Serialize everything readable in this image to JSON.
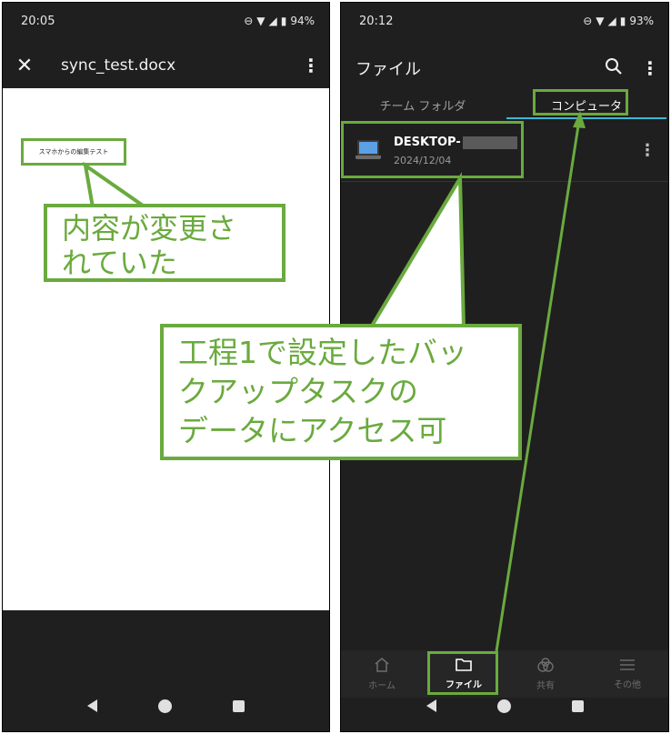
{
  "left_phone": {
    "status": {
      "time": "20:05",
      "battery": "94%"
    },
    "toolbar": {
      "title": "sync_test.docx"
    },
    "document": {
      "text": "スマホからの編集テスト"
    }
  },
  "right_phone": {
    "status": {
      "time": "20:12",
      "battery": "93%"
    },
    "toolbar": {
      "title": "ファイル"
    },
    "tabs": [
      {
        "label": "チーム フォルダ",
        "active": false
      },
      {
        "label": "コンピュータ",
        "active": true
      }
    ],
    "file": {
      "name": "DESKTOP-",
      "date": "2024/12/04"
    },
    "bottom_nav": [
      {
        "label": "ホーム",
        "icon": "home-icon",
        "active": false
      },
      {
        "label": "ファイル",
        "icon": "folder-icon",
        "active": true
      },
      {
        "label": "共有",
        "icon": "share-icon",
        "active": false
      },
      {
        "label": "その他",
        "icon": "menu-icon",
        "active": false
      }
    ]
  },
  "annotations": {
    "left_callout": {
      "line1": "内容が変更さ",
      "line2": "れていた"
    },
    "right_callout": {
      "line1": "工程1で設定したバッ",
      "line2": "クアップタスクの",
      "line3": "データにアクセス可"
    }
  },
  "colors": {
    "annotation": "#6aaa3e",
    "tab_underline": "#3bb8d4",
    "laptop": "#5ba0e6"
  }
}
